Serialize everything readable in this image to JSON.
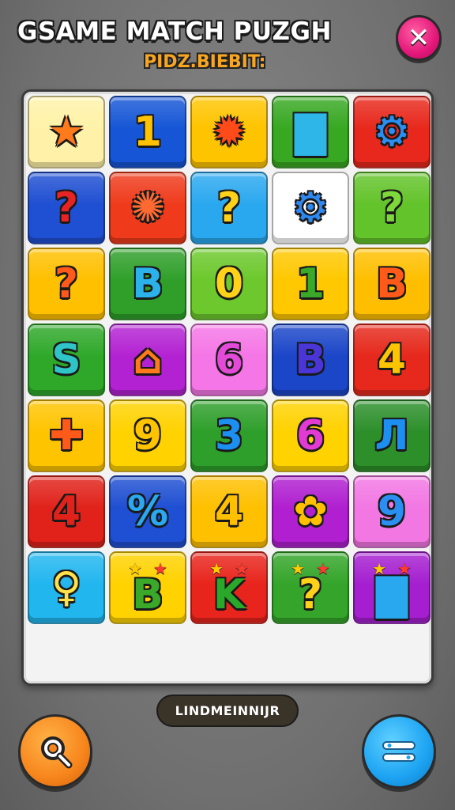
{
  "header": {
    "title": "GSAME MATCH PUZGH",
    "subtitle": "PIDZ.BIEBIT:",
    "close_icon": "close-icon",
    "close_symbol": "✕"
  },
  "board": {
    "tiles": [
      {
        "bg": "#fff2a8",
        "fg": "#ff7a1a",
        "sym": "★"
      },
      {
        "bg": "#1656d6",
        "fg": "#ffc200",
        "sym": "1"
      },
      {
        "bg": "#ffc400",
        "fg": "#ff4a1a",
        "sym": "✹"
      },
      {
        "bg": "#38a822",
        "fg": "#2eb6e8",
        "sym": "▇"
      },
      {
        "bg": "#e8281c",
        "fg": "#2a8ff2",
        "sym": "⚙"
      },
      {
        "bg": "#1f4fd2",
        "fg": "#e62424",
        "sym": "?"
      },
      {
        "bg": "#ef3b1c",
        "fg": "#ff6a33",
        "sym": "✺"
      },
      {
        "bg": "#2aa8ef",
        "fg": "#ffd21a",
        "sym": "?"
      },
      {
        "bg": "#ffffff",
        "fg": "#2f88f0",
        "sym": "⚙"
      },
      {
        "bg": "#63c32a",
        "fg": "#7ed83a",
        "sym": "?"
      },
      {
        "bg": "#ffc000",
        "fg": "#ff5a1a",
        "sym": "?"
      },
      {
        "bg": "#2f9f2a",
        "fg": "#2cb2ea",
        "sym": "B"
      },
      {
        "bg": "#6cc82c",
        "fg": "#ffd21a",
        "sym": "0"
      },
      {
        "bg": "#ffc800",
        "fg": "#3aa828",
        "sym": "1"
      },
      {
        "bg": "#ffbf00",
        "fg": "#ff5a1a",
        "sym": "B"
      },
      {
        "bg": "#2fa82a",
        "fg": "#2ec4c8",
        "sym": "S"
      },
      {
        "bg": "#b322d2",
        "fg": "#ff7a1a",
        "sym": "⌂"
      },
      {
        "bg": "#f576e6",
        "fg": "#e34ad8",
        "sym": "6"
      },
      {
        "bg": "#1b46c8",
        "fg": "#4a36d6",
        "sym": "B"
      },
      {
        "bg": "#e6291c",
        "fg": "#ffc400",
        "sym": "4"
      },
      {
        "bg": "#ffc400",
        "fg": "#ff5a1a",
        "sym": "✚"
      },
      {
        "bg": "#ffd200",
        "fg": "#ffc400",
        "sym": "9"
      },
      {
        "bg": "#2e9f2a",
        "fg": "#1c8ff0",
        "sym": "3"
      },
      {
        "bg": "#ffd200",
        "fg": "#e23ad2",
        "sym": "6"
      },
      {
        "bg": "#2c8f2a",
        "fg": "#1c8ff0",
        "sym": "Л"
      },
      {
        "bg": "#e0221a",
        "fg": "#e0221a",
        "sym": "4"
      },
      {
        "bg": "#1f4fd2",
        "fg": "#2aa8f0",
        "sym": "%"
      },
      {
        "bg": "#ffc000",
        "fg": "#ffc000",
        "sym": "4"
      },
      {
        "bg": "#b01fd0",
        "fg": "#ffc000",
        "sym": "✿"
      },
      {
        "bg": "#f277e3",
        "fg": "#2a8ff0",
        "sym": "9"
      },
      {
        "bg": "#22b6ef",
        "fg": "#ffe24a",
        "sym": "♀"
      },
      {
        "bg": "#ffd200",
        "fg": "#3aa828",
        "sym": "B",
        "stars": true
      },
      {
        "bg": "#e8251c",
        "fg": "#2aa82a",
        "sym": "K",
        "stars": true
      },
      {
        "bg": "#34a52a",
        "fg": "#ffd21a",
        "sym": "?",
        "stars": true
      },
      {
        "bg": "#a51fd0",
        "fg": "#2aa8ef",
        "sym": "▇",
        "stars": true
      }
    ]
  },
  "footer": {
    "counter_label": "LINDMEINNIJR",
    "search_icon": "search-icon",
    "menu_icon": "menu-icon"
  },
  "colors": {
    "accent_orange": "#f7851c",
    "accent_blue": "#1ca3f2",
    "accent_pink": "#e3177a"
  }
}
